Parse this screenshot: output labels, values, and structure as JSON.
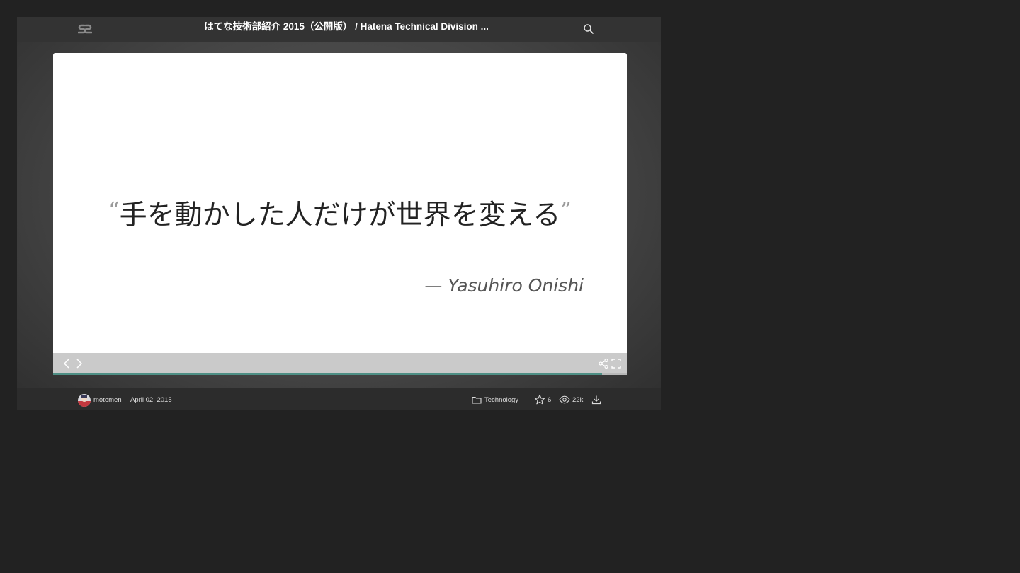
{
  "header": {
    "title": "はてな技術部紹介 2015（公開版） / Hatena Technical Division ...",
    "logo_icon": "speakerdeck-logo-icon",
    "search_icon": "search-icon"
  },
  "slide": {
    "quote_open": "“",
    "quote_text": "手を動かした人だけが世界を変える",
    "quote_close": "”",
    "author": "— Yasuhiro Onishi"
  },
  "controls": {
    "prev_icon": "chevron-left-icon",
    "next_icon": "chevron-right-icon",
    "share_icon": "share-icon",
    "fullscreen_icon": "fullscreen-icon",
    "progress": 0.957
  },
  "footer": {
    "username": "motemen",
    "date": "April 02, 2015",
    "category": "Technology",
    "stars": "6",
    "views": "22k",
    "download_icon": "download-icon"
  },
  "colors": {
    "page_bg": "#222222",
    "progress": "#4e8f85",
    "controls_bg": "#cacaca"
  }
}
